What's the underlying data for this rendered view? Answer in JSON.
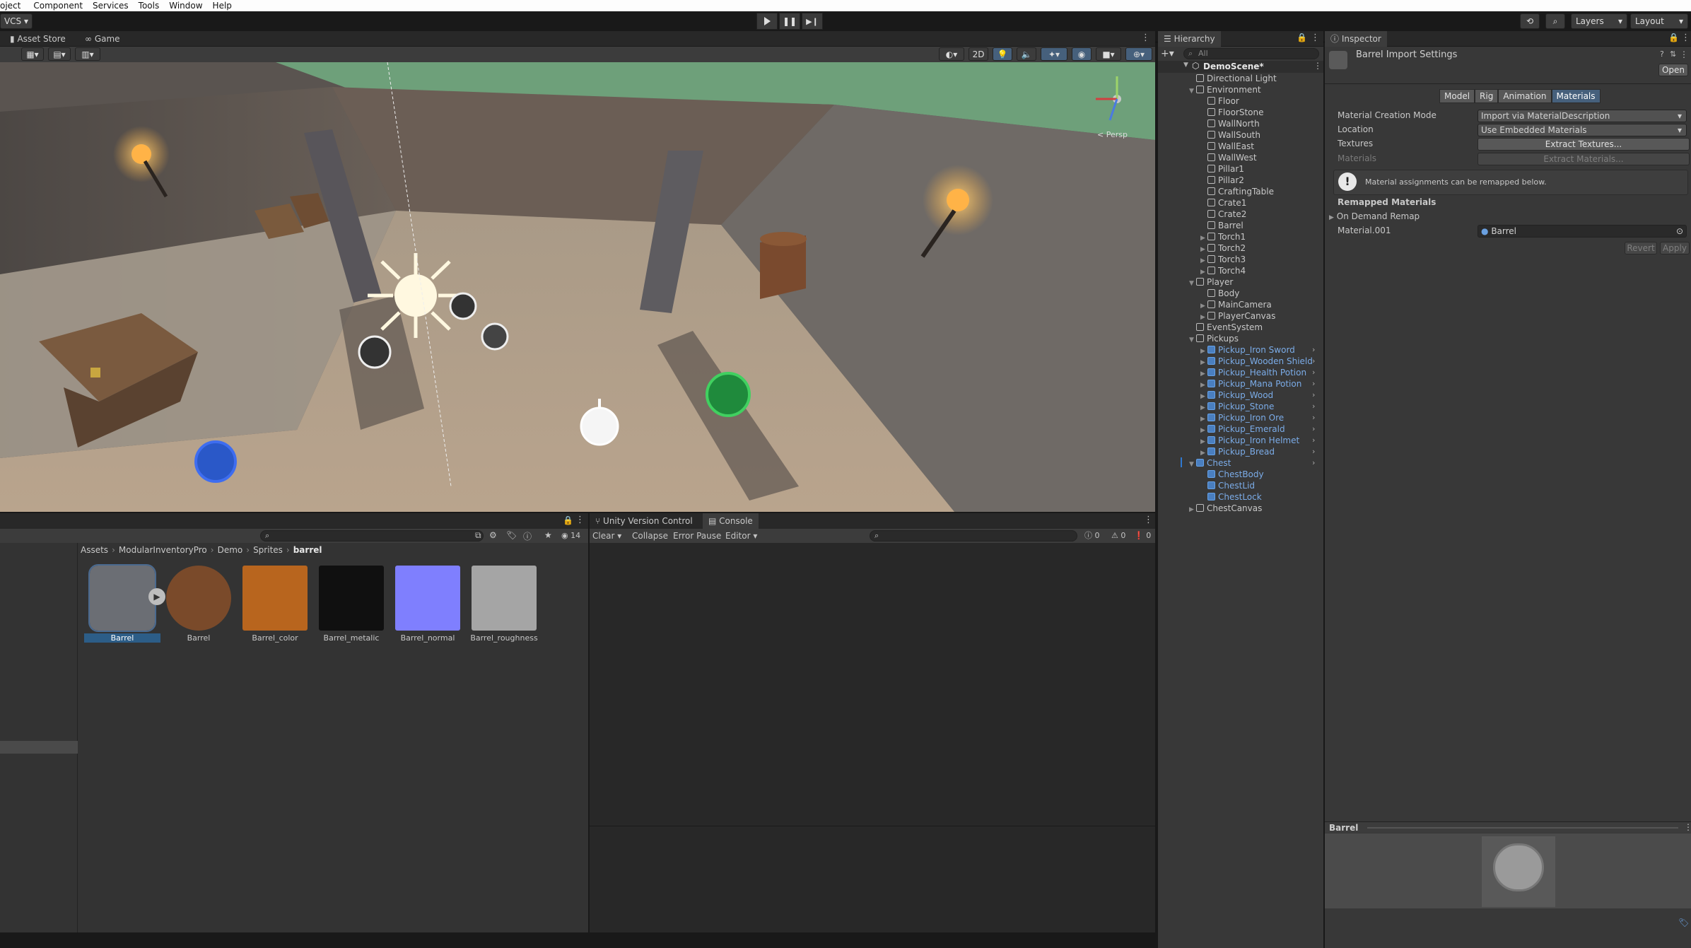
{
  "menu": [
    "oject",
    "Component",
    "Services",
    "Tools",
    "Window",
    "Help"
  ],
  "toolbar": {
    "vcs": "VCS",
    "layers": "Layers",
    "layout": "Layout"
  },
  "scene_tabs": {
    "asset_store": "Asset Store",
    "game": "Game"
  },
  "scene_toolbar": {
    "mode_2d": "2D",
    "persp": "< Persp"
  },
  "hierarchy": {
    "title": "Hierarchy",
    "search_placeholder": "All",
    "scene": "DemoScene*",
    "items": [
      {
        "label": "Directional Light",
        "depth": 1,
        "arrow": "",
        "prefab": false
      },
      {
        "label": "Environment",
        "depth": 1,
        "arrow": "down",
        "prefab": false
      },
      {
        "label": "Floor",
        "depth": 2,
        "arrow": "",
        "prefab": false
      },
      {
        "label": "FloorStone",
        "depth": 2,
        "arrow": "",
        "prefab": false
      },
      {
        "label": "WallNorth",
        "depth": 2,
        "arrow": "",
        "prefab": false
      },
      {
        "label": "WallSouth",
        "depth": 2,
        "arrow": "",
        "prefab": false
      },
      {
        "label": "WallEast",
        "depth": 2,
        "arrow": "",
        "prefab": false
      },
      {
        "label": "WallWest",
        "depth": 2,
        "arrow": "",
        "prefab": false
      },
      {
        "label": "Pillar1",
        "depth": 2,
        "arrow": "",
        "prefab": false
      },
      {
        "label": "Pillar2",
        "depth": 2,
        "arrow": "",
        "prefab": false
      },
      {
        "label": "CraftingTable",
        "depth": 2,
        "arrow": "",
        "prefab": false
      },
      {
        "label": "Crate1",
        "depth": 2,
        "arrow": "",
        "prefab": false
      },
      {
        "label": "Crate2",
        "depth": 2,
        "arrow": "",
        "prefab": false
      },
      {
        "label": "Barrel",
        "depth": 2,
        "arrow": "",
        "prefab": false
      },
      {
        "label": "Torch1",
        "depth": 2,
        "arrow": "right",
        "prefab": false
      },
      {
        "label": "Torch2",
        "depth": 2,
        "arrow": "right",
        "prefab": false
      },
      {
        "label": "Torch3",
        "depth": 2,
        "arrow": "right",
        "prefab": false
      },
      {
        "label": "Torch4",
        "depth": 2,
        "arrow": "right",
        "prefab": false
      },
      {
        "label": "Player",
        "depth": 1,
        "arrow": "down",
        "prefab": false
      },
      {
        "label": "Body",
        "depth": 2,
        "arrow": "",
        "prefab": false
      },
      {
        "label": "MainCamera",
        "depth": 2,
        "arrow": "right",
        "prefab": false
      },
      {
        "label": "PlayerCanvas",
        "depth": 2,
        "arrow": "right",
        "prefab": false
      },
      {
        "label": "EventSystem",
        "depth": 1,
        "arrow": "",
        "prefab": false
      },
      {
        "label": "Pickups",
        "depth": 1,
        "arrow": "down",
        "prefab": false
      },
      {
        "label": "Pickup_Iron Sword",
        "depth": 2,
        "arrow": "right",
        "prefab": true
      },
      {
        "label": "Pickup_Wooden Shield",
        "depth": 2,
        "arrow": "right",
        "prefab": true
      },
      {
        "label": "Pickup_Health Potion",
        "depth": 2,
        "arrow": "right",
        "prefab": true
      },
      {
        "label": "Pickup_Mana Potion",
        "depth": 2,
        "arrow": "right",
        "prefab": true
      },
      {
        "label": "Pickup_Wood",
        "depth": 2,
        "arrow": "right",
        "prefab": true
      },
      {
        "label": "Pickup_Stone",
        "depth": 2,
        "arrow": "right",
        "prefab": true
      },
      {
        "label": "Pickup_Iron Ore",
        "depth": 2,
        "arrow": "right",
        "prefab": true
      },
      {
        "label": "Pickup_Emerald",
        "depth": 2,
        "arrow": "right",
        "prefab": true
      },
      {
        "label": "Pickup_Iron Helmet",
        "depth": 2,
        "arrow": "right",
        "prefab": true
      },
      {
        "label": "Pickup_Bread",
        "depth": 2,
        "arrow": "right",
        "prefab": true
      },
      {
        "label": "Chest",
        "depth": 1,
        "arrow": "down",
        "prefab": true
      },
      {
        "label": "ChestBody",
        "depth": 2,
        "arrow": "",
        "prefab": true
      },
      {
        "label": "ChestLid",
        "depth": 2,
        "arrow": "",
        "prefab": true
      },
      {
        "label": "ChestLock",
        "depth": 2,
        "arrow": "",
        "prefab": true
      },
      {
        "label": "ChestCanvas",
        "depth": 1,
        "arrow": "right",
        "prefab": false
      }
    ]
  },
  "inspector": {
    "title": "Inspector",
    "header": "Barrel Import Settings",
    "open_button": "Open",
    "tabs": [
      "Model",
      "Rig",
      "Animation",
      "Materials"
    ],
    "active_tab": "Materials",
    "material_creation_mode_label": "Material Creation Mode",
    "material_creation_mode_value": "Import via MaterialDescription",
    "location_label": "Location",
    "location_value": "Use Embedded Materials",
    "textures_label": "Textures",
    "extract_textures": "Extract Textures...",
    "materials_label": "Materials",
    "extract_materials": "Extract Materials...",
    "info_text": "Material assignments can be remapped below.",
    "remapped_header": "Remapped Materials",
    "on_demand": "On Demand Remap",
    "material_slot": "Material.001",
    "material_value": "Barrel",
    "revert": "Revert",
    "apply": "Apply",
    "preview_title": "Barrel"
  },
  "project": {
    "breadcrumb": [
      "Assets",
      "ModularInventoryPro",
      "Demo",
      "Sprites",
      "barrel"
    ],
    "eye_count": "14",
    "assets": [
      {
        "label": "Barrel",
        "color": "#6b6e74",
        "selected": true
      },
      {
        "label": "Barrel",
        "color": "#7a4a2a",
        "selected": false
      },
      {
        "label": "Barrel_color",
        "color": "#b8651e",
        "selected": false
      },
      {
        "label": "Barrel_metalic",
        "color": "#101010",
        "selected": false
      },
      {
        "label": "Barrel_normal",
        "color": "#7f7ffe",
        "selected": false
      },
      {
        "label": "Barrel_roughness",
        "color": "#a5a5a5",
        "selected": false
      }
    ]
  },
  "console": {
    "tab_uvc": "Unity Version Control",
    "tab_console": "Console",
    "clear": "Clear",
    "collapse": "Collapse",
    "error_pause": "Error Pause",
    "editor": "Editor",
    "count_info": "0",
    "count_warn": "0",
    "count_err": "0"
  }
}
